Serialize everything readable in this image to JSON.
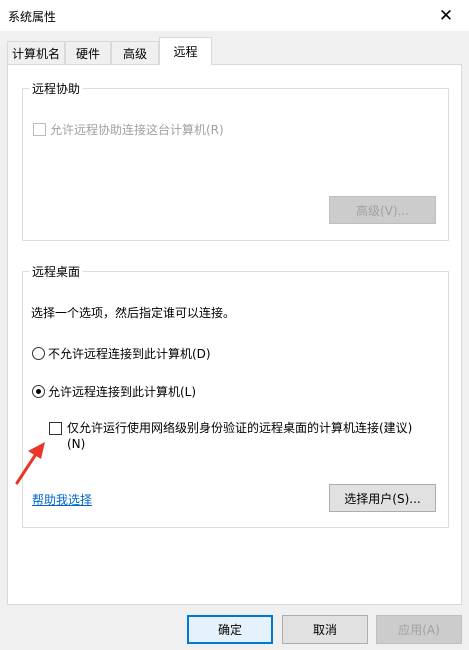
{
  "window": {
    "title": "系统属性",
    "close_glyph": "✕"
  },
  "tabs": [
    {
      "label": "计算机名",
      "active": false
    },
    {
      "label": "硬件",
      "active": false
    },
    {
      "label": "高级",
      "active": false
    },
    {
      "label": "远程",
      "active": true
    }
  ],
  "remote_assistance": {
    "group_label": "远程协助",
    "allow_checkbox_label": "允许远程协助连接这台计算机(R)",
    "allow_checked": false,
    "advanced_button_label": "高级(V)..."
  },
  "remote_desktop": {
    "group_label": "远程桌面",
    "instruction": "选择一个选项，然后指定谁可以连接。",
    "options": [
      {
        "label": "不允许远程连接到此计算机(D)",
        "selected": false
      },
      {
        "label": "允许远程连接到此计算机(L)",
        "selected": true
      }
    ],
    "nla_checkbox_label_line1": "仅允许运行使用网络级别身份验证的远程桌面的计算机连接(建议)",
    "nla_checkbox_label_line2": "(N)",
    "nla_checked": false,
    "help_link": "帮助我选择",
    "select_users_button_label": "选择用户(S)..."
  },
  "footer": {
    "ok_label": "确定",
    "cancel_label": "取消",
    "apply_label": "应用(A)"
  },
  "colors": {
    "accent": "#0078d7",
    "link": "#0066cc",
    "annotation_arrow": "#e8362b"
  }
}
